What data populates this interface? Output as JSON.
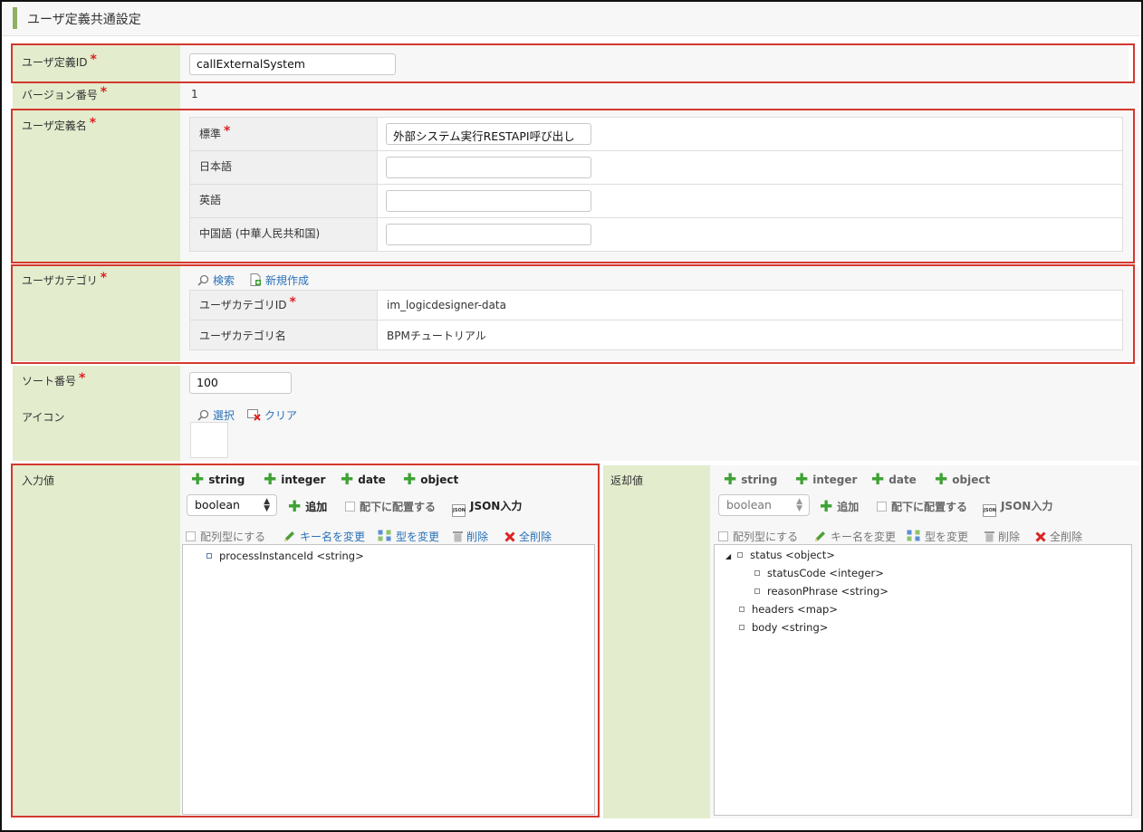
{
  "page": {
    "title": "ユーザ定義共通設定"
  },
  "form": {
    "user_id": {
      "label": "ユーザ定義ID",
      "value": "callExternalSystem"
    },
    "version": {
      "label": "バージョン番号",
      "value": "1"
    },
    "user_name": {
      "label": "ユーザ定義名",
      "rows": [
        {
          "label": "標準",
          "value": "外部システム実行RESTAPI呼び出し"
        },
        {
          "label": "日本語",
          "value": ""
        },
        {
          "label": "英語",
          "value": ""
        },
        {
          "label": "中国語 (中華人民共和国)",
          "value": ""
        }
      ]
    },
    "category": {
      "label": "ユーザカテゴリ",
      "search_label": "検索",
      "new_label": "新規作成",
      "id_label": "ユーザカテゴリID",
      "id_value": "im_logicdesigner-data",
      "name_label": "ユーザカテゴリ名",
      "name_value": "BPMチュートリアル"
    },
    "sort": {
      "label": "ソート番号",
      "value": "100"
    },
    "icon": {
      "label": "アイコン",
      "select_label": "選択",
      "clear_label": "クリア"
    }
  },
  "input_values": {
    "label": "入力値",
    "type_buttons": [
      "string",
      "integer",
      "date",
      "object"
    ],
    "type_select": "boolean",
    "add_label": "追加",
    "child_label": "配下に配置する",
    "json_label": "JSON入力",
    "array_label": "配列型にする",
    "rename_label": "キー名を変更",
    "retype_label": "型を変更",
    "delete_label": "削除",
    "delete_all_label": "全削除",
    "tree": [
      "processInstanceId <string>"
    ]
  },
  "return_values": {
    "label": "返却値",
    "type_buttons": [
      "string",
      "integer",
      "date",
      "object"
    ],
    "type_select": "boolean",
    "add_label": "追加",
    "child_label": "配下に配置する",
    "json_label": "JSON入力",
    "array_label": "配列型にする",
    "rename_label": "キー名を変更",
    "retype_label": "型を変更",
    "delete_label": "削除",
    "delete_all_label": "全削除",
    "tree": {
      "status": "status <object>",
      "status_code": "statusCode <integer>",
      "reason_phrase": "reasonPhrase <string>",
      "headers": "headers <map>",
      "body": "body <string>"
    }
  },
  "colors": {
    "label_bg": "#e3eccd",
    "highlight": "#d4382e",
    "accent": "#8fb063",
    "link": "#2a72b8",
    "add_icon": "#3ea133"
  }
}
